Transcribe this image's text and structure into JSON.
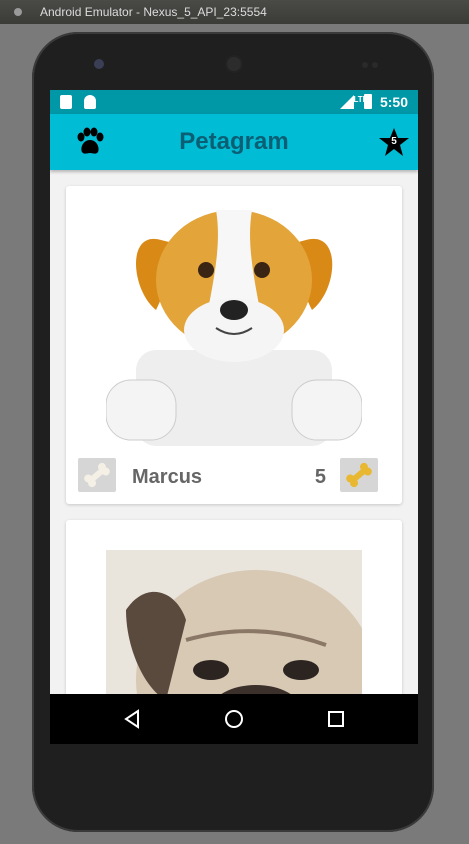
{
  "window": {
    "title": "Android Emulator - Nexus_5_API_23:5554"
  },
  "status_bar": {
    "network": "LTE",
    "time": "5:50"
  },
  "app_bar": {
    "title": "Petagram",
    "favorites_count": "5"
  },
  "pets": [
    {
      "name": "Marcus",
      "rating": "5"
    }
  ],
  "colors": {
    "status_bar": "#0097a7",
    "app_bar": "#00bcd4",
    "title_text": "#0b5f75"
  },
  "icons": [
    "paw-icon",
    "star-icon",
    "bone-icon",
    "back-icon",
    "home-icon",
    "recents-icon"
  ]
}
